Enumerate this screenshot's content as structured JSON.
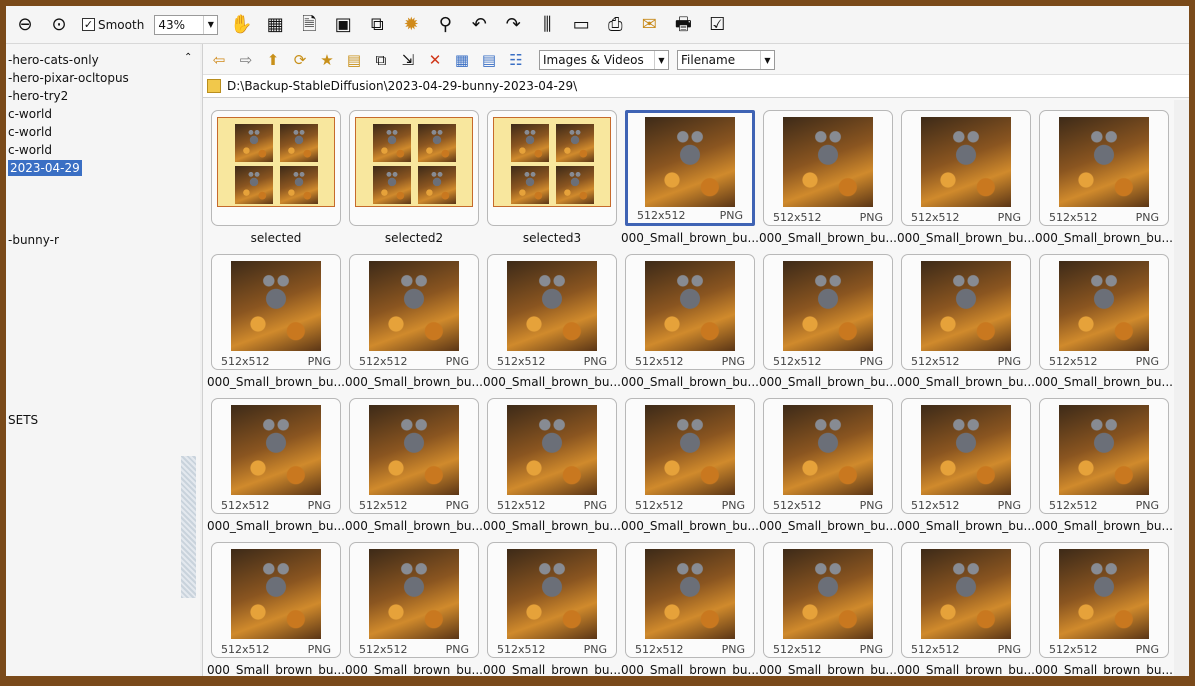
{
  "toolbar": {
    "smooth_label": "Smooth",
    "smooth_checked": true,
    "zoom_value": "43%",
    "icons": [
      "zoom-out-icon",
      "zoom-fit-icon",
      "hand-tool-icon",
      "filmstrip-icon",
      "image-info-icon",
      "batch-icon",
      "convert-icon",
      "settings-sun-icon",
      "stamp-icon",
      "undo-icon",
      "redo-icon",
      "compare-icon",
      "slideshow-icon",
      "scan-icon",
      "email-icon",
      "print-icon",
      "edit-list-icon"
    ]
  },
  "tree": {
    "items": [
      {
        "label": "-hero-cats-only",
        "selected": false
      },
      {
        "label": "-hero-pixar-ocltopus",
        "selected": false
      },
      {
        "label": "-hero-try2",
        "selected": false
      },
      {
        "label": "c-world",
        "selected": false
      },
      {
        "label": "c-world",
        "selected": false
      },
      {
        "label": "c-world",
        "selected": false
      },
      {
        "label": "2023-04-29",
        "selected": true
      },
      {
        "label": "-bunny-r",
        "selected": false
      },
      {
        "label": "SETS",
        "selected": false
      }
    ]
  },
  "nav": {
    "filter_value": "Images & Videos",
    "sort_value": "Filename"
  },
  "path": "D:\\Backup-StableDiffusion\\2023-04-29-bunny-2023-04-29\\",
  "thumbnails": [
    {
      "caption": "selected",
      "kind": "collage",
      "res": "",
      "fmt": ""
    },
    {
      "caption": "selected2",
      "kind": "collage",
      "res": "",
      "fmt": ""
    },
    {
      "caption": "selected3",
      "kind": "collage",
      "res": "",
      "fmt": ""
    },
    {
      "caption": "000_Small_brown_bu...",
      "kind": "image",
      "res": "512x512",
      "fmt": "PNG",
      "selected": true
    },
    {
      "caption": "000_Small_brown_bu...",
      "kind": "image",
      "res": "512x512",
      "fmt": "PNG"
    },
    {
      "caption": "000_Small_brown_bu...",
      "kind": "image",
      "res": "512x512",
      "fmt": "PNG"
    },
    {
      "caption": "000_Small_brown_bu...",
      "kind": "image",
      "res": "512x512",
      "fmt": "PNG"
    },
    {
      "caption": "000_Small_brown_bu...",
      "kind": "image",
      "res": "512x512",
      "fmt": "PNG"
    },
    {
      "caption": "000_Small_brown_bu...",
      "kind": "image",
      "res": "512x512",
      "fmt": "PNG"
    },
    {
      "caption": "000_Small_brown_bu...",
      "kind": "image",
      "res": "512x512",
      "fmt": "PNG"
    },
    {
      "caption": "000_Small_brown_bu...",
      "kind": "image",
      "res": "512x512",
      "fmt": "PNG"
    },
    {
      "caption": "000_Small_brown_bu...",
      "kind": "image",
      "res": "512x512",
      "fmt": "PNG"
    },
    {
      "caption": "000_Small_brown_bu...",
      "kind": "image",
      "res": "512x512",
      "fmt": "PNG"
    },
    {
      "caption": "000_Small_brown_bu...",
      "kind": "image",
      "res": "512x512",
      "fmt": "PNG"
    },
    {
      "caption": "000_Small_brown_bu...",
      "kind": "image",
      "res": "512x512",
      "fmt": "PNG"
    },
    {
      "caption": "000_Small_brown_bu...",
      "kind": "image",
      "res": "512x512",
      "fmt": "PNG"
    },
    {
      "caption": "000_Small_brown_bu...",
      "kind": "image",
      "res": "512x512",
      "fmt": "PNG"
    },
    {
      "caption": "000_Small_brown_bu...",
      "kind": "image",
      "res": "512x512",
      "fmt": "PNG"
    },
    {
      "caption": "000_Small_brown_bu...",
      "kind": "image",
      "res": "512x512",
      "fmt": "PNG"
    },
    {
      "caption": "000_Small_brown_bu...",
      "kind": "image",
      "res": "512x512",
      "fmt": "PNG"
    },
    {
      "caption": "000_Small_brown_bu...",
      "kind": "image",
      "res": "512x512",
      "fmt": "PNG"
    },
    {
      "caption": "000_Small_brown_bu...",
      "kind": "image",
      "res": "512x512",
      "fmt": "PNG"
    },
    {
      "caption": "000_Small_brown_bu...",
      "kind": "image",
      "res": "512x512",
      "fmt": "PNG"
    },
    {
      "caption": "000_Small_brown_bu...",
      "kind": "image",
      "res": "512x512",
      "fmt": "PNG"
    },
    {
      "caption": "000_Small_brown_bu...",
      "kind": "image",
      "res": "512x512",
      "fmt": "PNG"
    },
    {
      "caption": "000_Small_brown_bu...",
      "kind": "image",
      "res": "512x512",
      "fmt": "PNG"
    },
    {
      "caption": "000_Small_brown_bu...",
      "kind": "image",
      "res": "512x512",
      "fmt": "PNG"
    },
    {
      "caption": "000_Small_brown_bu...",
      "kind": "image",
      "res": "512x512",
      "fmt": "PNG"
    }
  ]
}
